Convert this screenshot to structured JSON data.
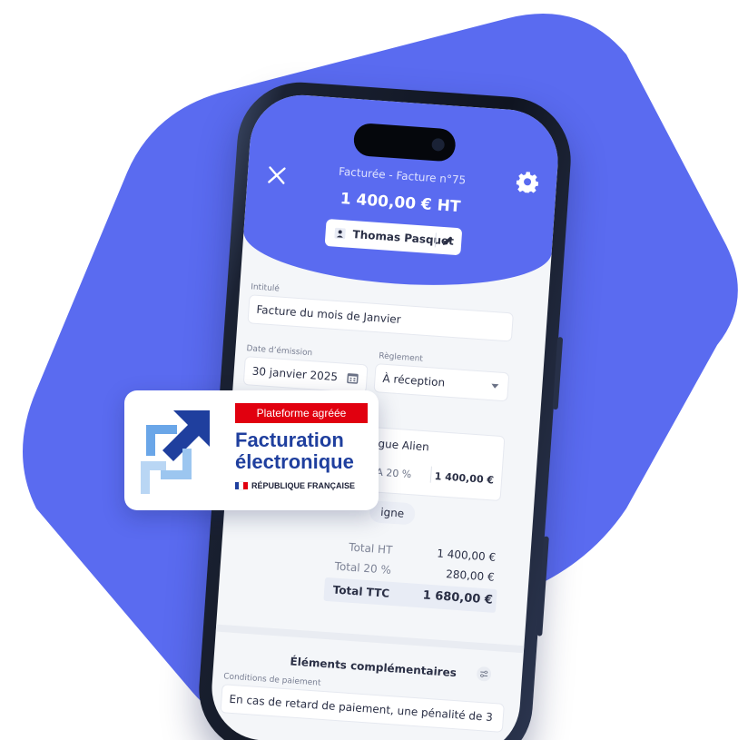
{
  "colors": {
    "blob": "#5a6bf0",
    "header": "#5a6bf0",
    "republic_red": "#e1000f",
    "republic_blue": "#1f3f9e"
  },
  "header": {
    "status_line": "Facturée - Facture n°75",
    "amount": "1 400,00 € HT",
    "client_name": "Thomas Pasquet",
    "close_icon": "close-icon",
    "settings_icon": "gear-icon",
    "edit_icon": "pencil-icon"
  },
  "form": {
    "title_label": "Intitulé",
    "title_value": "Facture du mois de Janvier",
    "date_label": "Date d’émission",
    "date_value": "30 janvier 2025",
    "payment_label": "Règlement",
    "payment_value": "À réception",
    "line_name": "gue Alien",
    "line_vat": "A 20 %",
    "line_amount": "1 400,00 €",
    "add_line_label": "igne"
  },
  "totals": {
    "ht_label": "Total HT",
    "ht_value": "1 400,00 €",
    "vat_label": "Total 20 %",
    "vat_value": "280,00 €",
    "ttc_label": "Total TTC",
    "ttc_value": "1 680,00 €"
  },
  "extras": {
    "section_title": "Éléments complémentaires",
    "conditions_label": "Conditions de paiement",
    "conditions_value": "En cas de retard de paiement, une pénalité de 3"
  },
  "badge": {
    "banner": "Plateforme agréée",
    "line1": "Facturation",
    "line2": "électronique",
    "republic": "RÉPUBLIQUE FRANÇAISE"
  }
}
